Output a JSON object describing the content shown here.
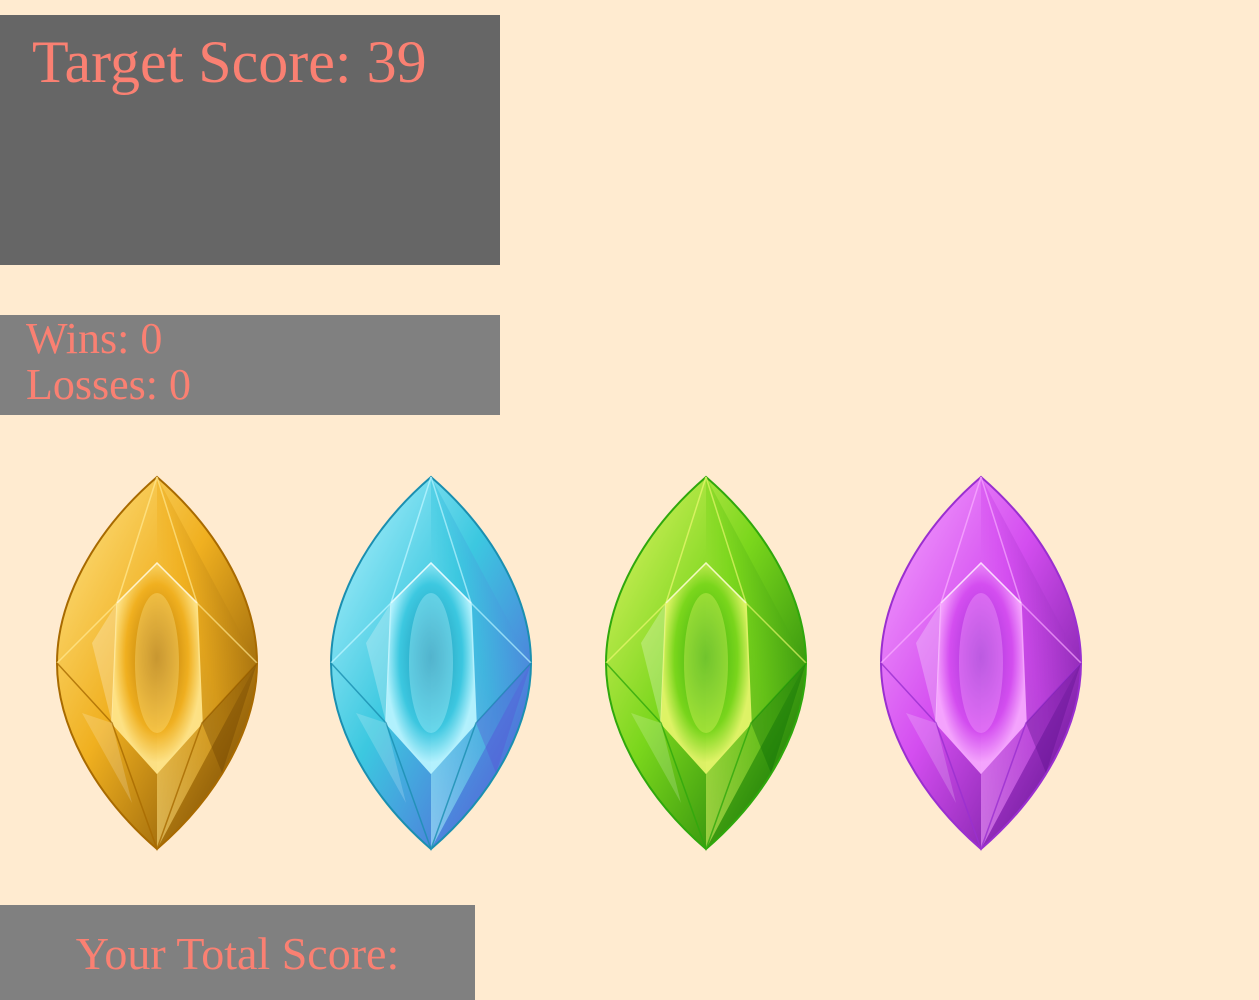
{
  "target": {
    "label": "Target Score:",
    "value": "39",
    "text": "Target Score: 39"
  },
  "record": {
    "wins_text": "Wins: 0",
    "losses_text": "Losses: 0",
    "wins": 0,
    "losses": 0
  },
  "crystals": [
    {
      "icon": "yellow-crystal-icon",
      "colors": {
        "light": "#ffe58a",
        "mid": "#f0b020",
        "dark": "#a86a00",
        "deep": "#6b3f00"
      }
    },
    {
      "icon": "blue-crystal-icon",
      "colors": {
        "light": "#b8f4ff",
        "mid": "#3cc8e0",
        "dark": "#1a8fb0",
        "deep": "#5a4fd8"
      }
    },
    {
      "icon": "green-crystal-icon",
      "colors": {
        "light": "#e4f56a",
        "mid": "#7ad61c",
        "dark": "#2fa80c",
        "deep": "#0a6a06"
      }
    },
    {
      "icon": "purple-crystal-icon",
      "colors": {
        "light": "#f7a8ff",
        "mid": "#d44ef0",
        "dark": "#9a2fd0",
        "deep": "#5a0f8a"
      }
    }
  ],
  "total": {
    "label": "Your Total Score:"
  },
  "colors": {
    "background": "#ffebd0",
    "text": "#fa8072",
    "panel_dark": "#666666",
    "panel": "#808080"
  }
}
